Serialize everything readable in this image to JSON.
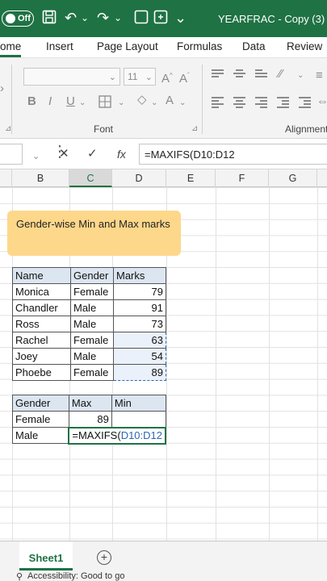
{
  "titlebar": {
    "autosave_label": "Off",
    "doc_title": "YEARFRAC - Copy (3)",
    "undo_chev": "⌄",
    "redo_chev": "⌄"
  },
  "tabs": [
    "ome",
    "Insert",
    "Page Layout",
    "Formulas",
    "Data",
    "Review"
  ],
  "ribbon": {
    "font_size": "11",
    "font_group_label": "Font",
    "alignment_group_label": "Alignment",
    "bold": "B",
    "italic": "I",
    "underline": "U"
  },
  "formula_bar": {
    "name_box": "",
    "formula": "=MAXIFS(D10:D12"
  },
  "columns": [
    "B",
    "C",
    "D",
    "E",
    "F",
    "G"
  ],
  "note": "Gender-wise Min and Max marks",
  "data_table": {
    "headers": [
      "Name",
      "Gender",
      "Marks"
    ],
    "rows": [
      [
        "Monica",
        "Female",
        "79"
      ],
      [
        "Chandler",
        "Male",
        "91"
      ],
      [
        "Ross",
        "Male",
        "73"
      ],
      [
        "Rachel",
        "Female",
        "63"
      ],
      [
        "Joey",
        "Male",
        "54"
      ],
      [
        "Phoebe",
        "Female",
        "89"
      ]
    ]
  },
  "summary_table": {
    "headers": [
      "Gender",
      "Max",
      "Min"
    ],
    "rows": [
      [
        "Female",
        "89",
        ""
      ],
      [
        "Male",
        "=MAXIFS(",
        "D10:D12"
      ]
    ]
  },
  "sheet_tab": "Sheet1",
  "status": "Accessibility: Good to go",
  "colors": {
    "accent": "#1f7244",
    "note": "#fdd78a",
    "selection": "#2f66b3"
  }
}
